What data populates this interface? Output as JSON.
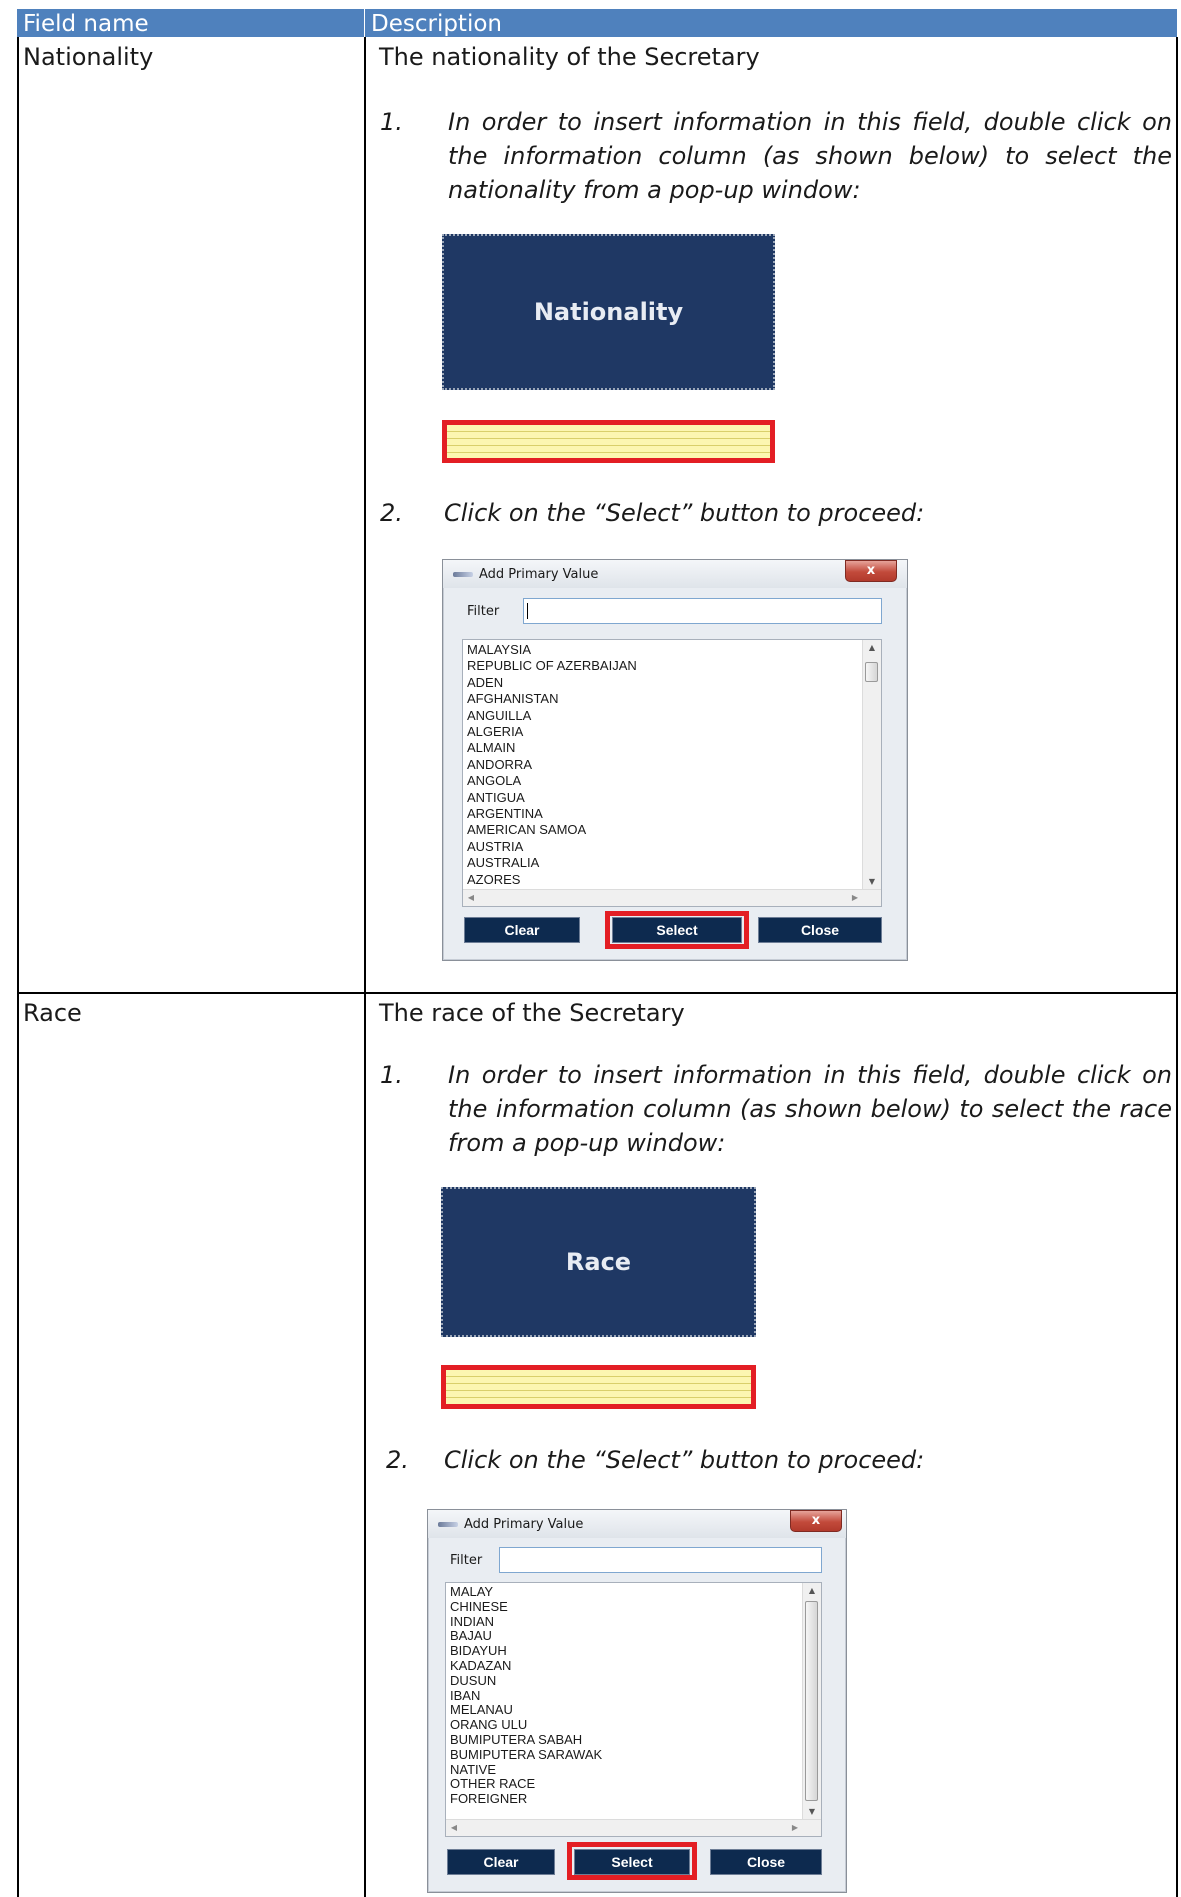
{
  "header": {
    "field_name": "Field name",
    "description": "Description"
  },
  "rows": [
    {
      "field": "Nationality",
      "intro": "The nationality of the Secretary",
      "step1": {
        "number": "1.",
        "text": "In order to insert information in this field, double click on the information column (as shown below) to select the nationality from a pop-up window:"
      },
      "button_label": "Nationality",
      "step2": {
        "number": "2.",
        "text": "Click on the “Select” button to proceed:"
      },
      "dialog": {
        "title": "Add Primary Value",
        "close_glyph": "x",
        "filter_label": "Filter",
        "filter_value": "",
        "items": [
          "MALAYSIA",
          "REPUBLIC OF AZERBAIJAN",
          "ADEN",
          "AFGHANISTAN",
          "ANGUILLA",
          "ALGERIA",
          "ALMAIN",
          "ANDORRA",
          "ANGOLA",
          "ANTIGUA",
          "ARGENTINA",
          "AMERICAN SAMOA",
          "AUSTRIA",
          "AUSTRALIA",
          "AZORES"
        ],
        "buttons": {
          "clear": "Clear",
          "select": "Select",
          "close": "Close"
        }
      }
    },
    {
      "field": "Race",
      "intro": "The race of the Secretary",
      "step1": {
        "number": "1.",
        "text": "In order to insert information in this field, double click on the information column (as shown below) to select the race from a pop-up window:"
      },
      "button_label": "Race",
      "step2": {
        "number": "2.",
        "text": "Click on the “Select” button to proceed:"
      },
      "dialog": {
        "title": "Add Primary Value",
        "close_glyph": "x",
        "filter_label": "Filter",
        "filter_value": "",
        "items": [
          "MALAY",
          "CHINESE",
          "INDIAN",
          "BAJAU",
          "BIDAYUH",
          "KADAZAN",
          "DUSUN",
          "IBAN",
          "MELANAU",
          "ORANG ULU",
          "BUMIPUTERA SABAH",
          "BUMIPUTERA SARAWAK",
          "NATIVE",
          "OTHER RACE",
          "FOREIGNER"
        ],
        "buttons": {
          "clear": "Clear",
          "select": "Select",
          "close": "Close"
        }
      }
    }
  ],
  "colors": {
    "header_bg": "#4f81bd",
    "nav_box_bg": "#1f3864",
    "highlight_red": "#e31e24",
    "highlight_yellow": "#fcf6b1",
    "dialog_button_bg": "#0d2a4f"
  }
}
